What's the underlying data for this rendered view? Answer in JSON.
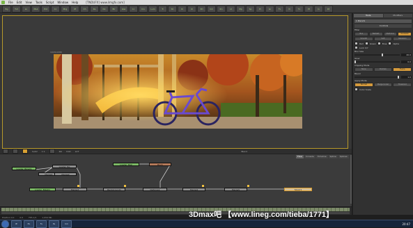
{
  "menubar": {
    "items": [
      "File",
      "Edit",
      "View",
      "Tools",
      "Script",
      "Window",
      "Help"
    ],
    "window_title": "[TNDUFX] www.ilmgfx.com]"
  },
  "toolbar": {
    "tools": [
      "Bg",
      "Txt",
      "Ln",
      "Msk",
      "Pnt",
      "Cc",
      "Mrg",
      "Xf",
      "Ch",
      "Rs",
      "Dx",
      "Blr",
      "Glw",
      "Cc",
      "Crv",
      "Lum",
      "Tr",
      "Sh",
      "Kl",
      "Ul",
      "3D",
      "Cm",
      "Rn",
      "Lt",
      "Mp",
      "Sp",
      "Pr",
      "Gr",
      "Fx",
      "Vl",
      "Tx",
      "Pt",
      "In",
      "Dt"
    ]
  },
  "viewer": {
    "info_text": "1920x1080",
    "controls": [
      "SubV",
      "1:1",
      "RoI",
      "DoD",
      "LUT"
    ],
    "status_right": "Blend"
  },
  "inspector": {
    "tabs": [
      "Tools",
      "Modifiers"
    ],
    "tool_title": "1 Blend1",
    "section_controls": "Controls",
    "filter_label": "Filter",
    "filter_buttons": [
      "Box",
      "Bartlett",
      "Multi-box",
      "Gaussian"
    ],
    "filter_buttons_2": [
      "Smooth",
      "Soft",
      "Gaussian"
    ],
    "channel_labels": [
      "Red",
      "Green",
      "Blue",
      "Alpha"
    ],
    "lock_xy": "Lock X/Y",
    "blur_size_label": "Blur Size",
    "blur_size_value": "20.0",
    "glow_label": "Glow",
    "glow_value": "0.0",
    "clipping_label": "Clipping Mode",
    "clipping_buttons": [
      "None",
      "Domain",
      "Frame"
    ],
    "blend_label": "Blend",
    "blend_value": "1.0",
    "apply_label": "Apply Mode",
    "apply_buttons": [
      "Normal",
      "Merge Under",
      "Threshold"
    ],
    "color_scale_label": "Color Scale"
  },
  "flow": {
    "tabs": [
      "Flow",
      "Console",
      "Timeline",
      "Spline",
      "Splines"
    ],
    "nodes": [
      {
        "label": "Loader_Bike01"
      },
      {
        "label": "Loader_Bg"
      },
      {
        "label": "Merge1"
      },
      {
        "label": "Merge2"
      },
      {
        "label": "Blur1"
      },
      {
        "label": "Loader_Bg2"
      },
      {
        "label": "Merge3"
      },
      {
        "label": "Background1"
      },
      {
        "label": "Defocus1"
      },
      {
        "label": "Merge4"
      },
      {
        "label": "Merge5"
      },
      {
        "label": "Saver1"
      }
    ]
  },
  "timeline": {
    "current_frame": "0.0"
  },
  "status": {
    "left": "Position 0.0",
    "mid": "FPS 1/1",
    "mem": "1,054 Mb"
  },
  "taskbar": {
    "apps": [
      "IE",
      "Ex",
      "Fu",
      "Ps",
      "Cm"
    ],
    "clock": "20:47"
  },
  "watermark": "3Dmax吧 【www.lineg.com/tieba/1771】"
}
